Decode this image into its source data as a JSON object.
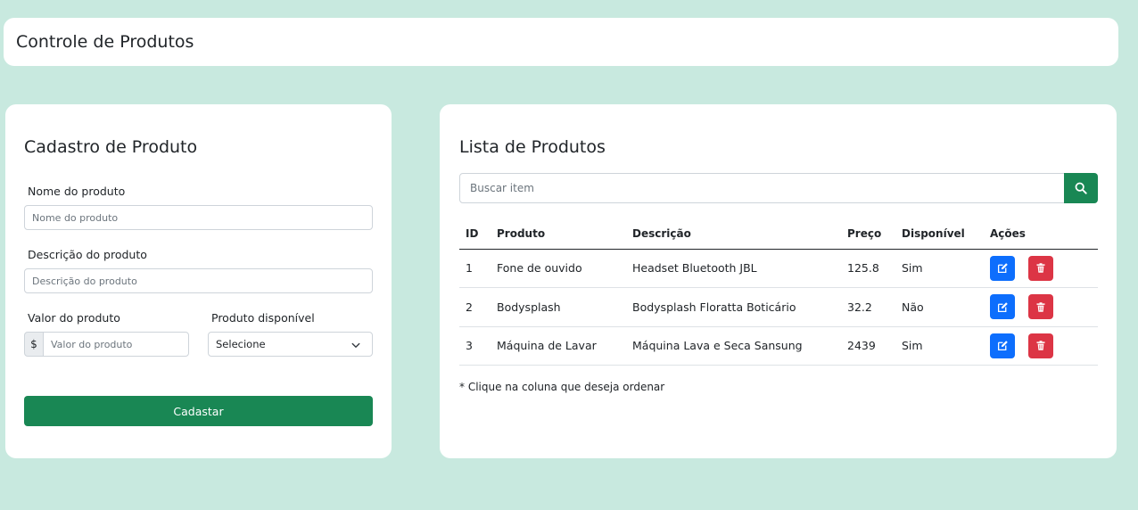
{
  "header": {
    "title": "Controle de Produtos"
  },
  "form": {
    "title": "Cadastro de Produto",
    "name_label": "Nome do produto",
    "name_placeholder": "Nome do produto",
    "description_label": "Descrição do produto",
    "description_placeholder": "Descrição do produto",
    "value_label": "Valor do produto",
    "value_prefix": "$",
    "value_placeholder": "Valor do produto",
    "available_label": "Produto disponível",
    "available_selected": "Selecione",
    "submit_label": "Cadastar"
  },
  "list": {
    "title": "Lista de Produtos",
    "search_placeholder": "Buscar item",
    "columns": [
      "ID",
      "Produto",
      "Descrição",
      "Preço",
      "Disponível",
      "Ações"
    ],
    "rows": [
      {
        "id": "1",
        "product": "Fone de ouvido",
        "description": "Headset Bluetooth JBL",
        "price": "125.8",
        "available": "Sim"
      },
      {
        "id": "2",
        "product": "Bodysplash",
        "description": "Bodysplash Floratta Boticário",
        "price": "32.2",
        "available": "Não"
      },
      {
        "id": "3",
        "product": "Máquina de Lavar",
        "description": "Máquina Lava e Seca Sansung",
        "price": "2439",
        "available": "Sim"
      }
    ],
    "note": "* Clique na coluna que deseja ordenar"
  },
  "colors": {
    "background": "#c8e9df",
    "success": "#198754",
    "primary": "#0d6efd",
    "danger": "#dc3545"
  },
  "icons": {
    "search": "search-icon",
    "edit": "edit-icon",
    "delete": "trash-icon",
    "select": "chevron-down-icon"
  }
}
